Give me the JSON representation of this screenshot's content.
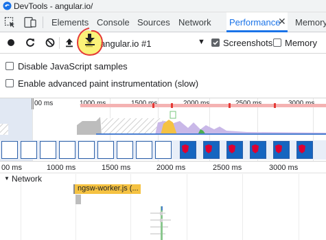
{
  "window": {
    "title": "DevTools - angular.io/"
  },
  "tabs": [
    {
      "label": "Elements"
    },
    {
      "label": "Console"
    },
    {
      "label": "Sources"
    },
    {
      "label": "Network"
    },
    {
      "label": "Performance"
    },
    {
      "label": "Memory"
    }
  ],
  "active_tab_close": "✕",
  "toolbar": {
    "profile": "angular.io #1",
    "screenshots_label": "Screenshots",
    "screenshots_checked": true,
    "memory_label": "Memory",
    "memory_checked": false
  },
  "settings": [
    {
      "label": "Disable JavaScript samples",
      "checked": false
    },
    {
      "label": "Enable advanced paint instrumentation (slow)",
      "checked": false
    }
  ],
  "overview": {
    "ticks": [
      "00 ms",
      "1000 ms",
      "1500 ms",
      "2000 ms",
      "2500 ms",
      "3000 ms"
    ]
  },
  "timeline": {
    "ticks": [
      "00 ms",
      "1000 ms",
      "1500 ms",
      "2000 ms",
      "2500 ms",
      "3000 ms"
    ],
    "network_header": "Network",
    "request_label": "ngsw-worker.js (..."
  },
  "icons": {
    "record": "record-icon",
    "reload": "reload-icon",
    "clear": "clear-icon",
    "upload": "upload-icon",
    "download": "download-icon"
  },
  "colors": {
    "accent": "#1a73e8",
    "annotation": "#e53935",
    "highlight": "#f9ee4c",
    "request": "#f5c242"
  }
}
